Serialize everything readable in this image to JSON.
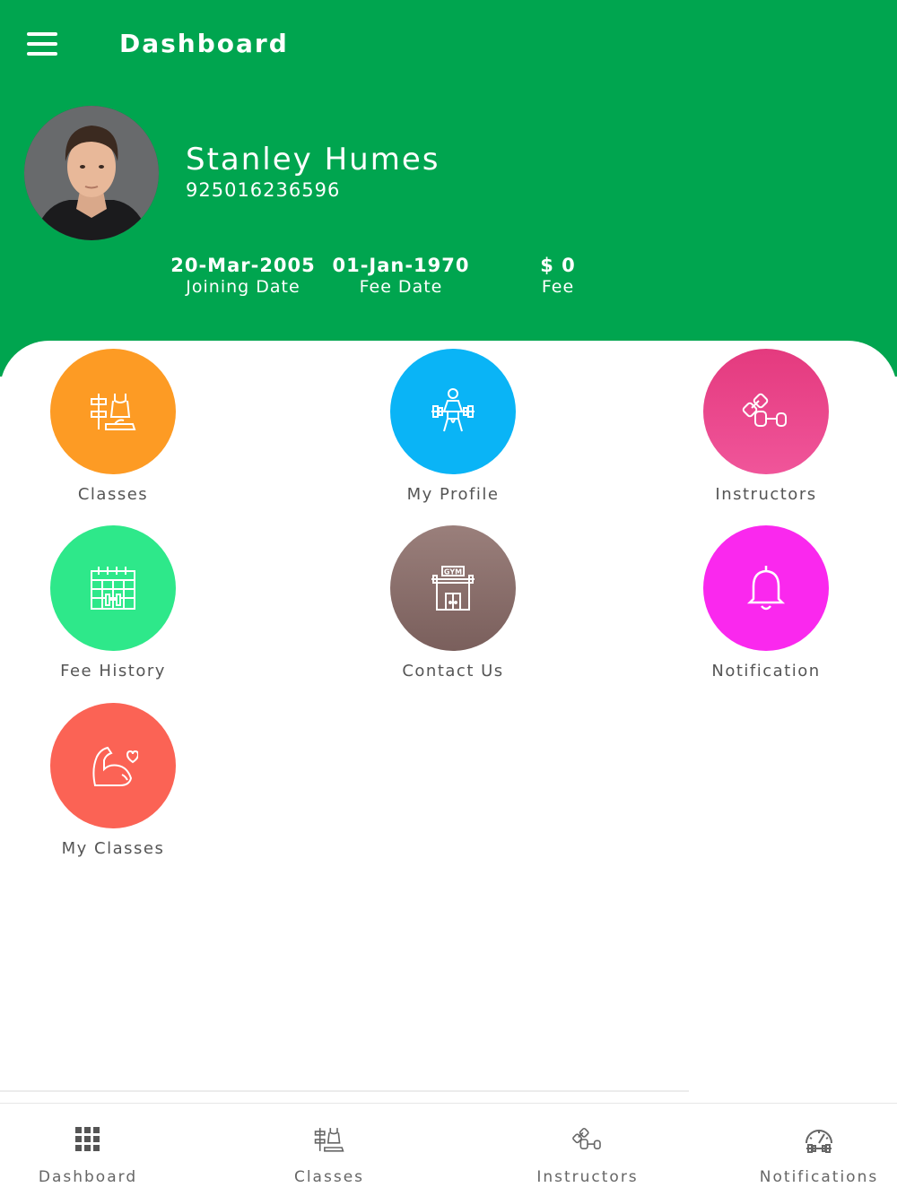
{
  "header": {
    "title": "Dashboard",
    "background": "#00a54f"
  },
  "profile": {
    "name": "Stanley Humes",
    "phone": "925016236596"
  },
  "stats": [
    {
      "value": "20-Mar-2005",
      "label": "Joining Date"
    },
    {
      "value": "01-Jan-1970",
      "label": "Fee Date"
    },
    {
      "value": "$ 0",
      "label": "Fee"
    }
  ],
  "tiles": [
    {
      "label": "Classes",
      "icon": "gym-equipment-icon",
      "color": "#fd9b24"
    },
    {
      "label": "My Profile",
      "icon": "weightlifter-icon",
      "color": "#0ab4f6"
    },
    {
      "label": "Instructors",
      "icon": "dumbbells-icon",
      "color": "#ec4287"
    },
    {
      "label": "Fee History",
      "icon": "calendar-barbell-icon",
      "color": "#2ee88a"
    },
    {
      "label": "Contact Us",
      "icon": "gym-building-icon",
      "color": "#8a6e6b"
    },
    {
      "label": "Notification",
      "icon": "bell-icon",
      "color": "#fa28ee"
    },
    {
      "label": "My Classes",
      "icon": "flexed-arm-heart-icon",
      "color": "#fb6355"
    }
  ],
  "bottom_nav": [
    {
      "label": "Dashboard",
      "icon": "grid-icon"
    },
    {
      "label": "Classes",
      "icon": "gym-equipment-icon"
    },
    {
      "label": "Instructors",
      "icon": "dumbbells-icon"
    },
    {
      "label": "Notifications",
      "icon": "gauge-barbell-icon"
    }
  ]
}
